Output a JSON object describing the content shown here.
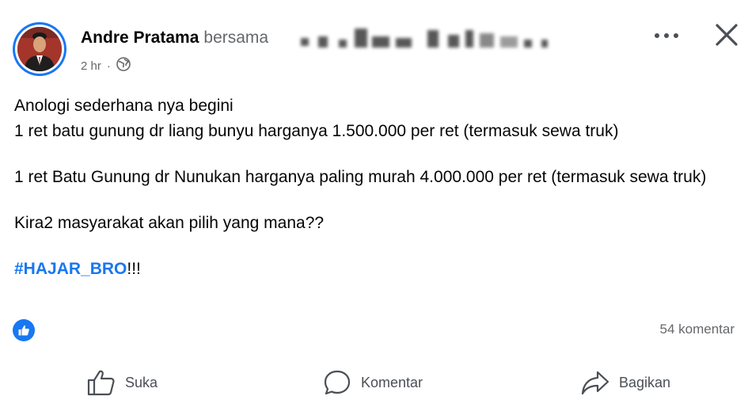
{
  "post": {
    "author": "Andre Pratama",
    "with_label": "bersama",
    "time": "2 hr",
    "audience_icon": "globe-icon",
    "lines": [
      "Anologi sederhana nya begini",
      "1 ret batu gunung dr liang bunyu harganya 1.500.000 per ret (termasuk sewa truk)",
      "1 ret Batu Gunung dr Nunukan harganya paling murah 4.000.000 per ret (termasuk sewa truk)",
      "Kira2 masyarakat akan pilih yang mana??"
    ],
    "hashtag": "#HAJAR_BRO",
    "hashtag_suffix": "!!!"
  },
  "stats": {
    "reaction_icon": "like-icon",
    "comments": "54 komentar"
  },
  "actions": {
    "like": "Suka",
    "comment": "Komentar",
    "share": "Bagikan"
  },
  "colors": {
    "accent": "#1877f2",
    "secondary_text": "#65676b"
  }
}
